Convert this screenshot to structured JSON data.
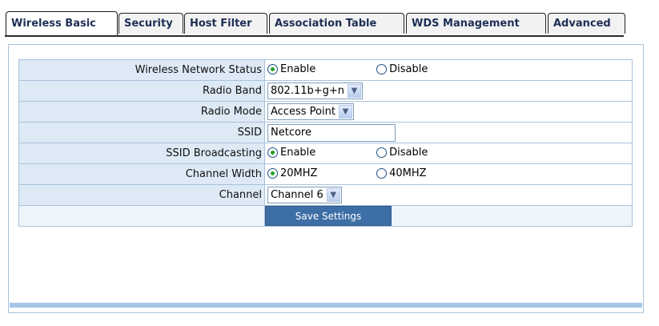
{
  "tabs": [
    {
      "label": "Wireless Basic",
      "active": true
    },
    {
      "label": "Security",
      "active": false
    },
    {
      "label": "Host Filter",
      "active": false
    },
    {
      "label": "Association Table",
      "active": false
    },
    {
      "label": "WDS Management",
      "active": false
    },
    {
      "label": "Advanced",
      "active": false
    }
  ],
  "form": {
    "network_status": {
      "label": "Wireless Network Status",
      "options": [
        "Enable",
        "Disable"
      ],
      "selected": "Enable"
    },
    "radio_band": {
      "label": "Radio Band",
      "value": "802.11b+g+n"
    },
    "radio_mode": {
      "label": "Radio Mode",
      "value": "Access Point"
    },
    "ssid": {
      "label": "SSID",
      "value": "Netcore"
    },
    "ssid_broadcasting": {
      "label": "SSID Broadcasting",
      "options": [
        "Enable",
        "Disable"
      ],
      "selected": "Enable"
    },
    "channel_width": {
      "label": "Channel Width",
      "options": [
        "20MHZ",
        "40MHZ"
      ],
      "selected": "20MHZ"
    },
    "channel": {
      "label": "Channel",
      "value": "Channel 6"
    },
    "save_label": "Save Settings"
  },
  "colors": {
    "label_bg": "#dde9f5",
    "border": "#a9c2dc",
    "button_bg": "#3e6ea6",
    "radio_dot": "#21a121"
  },
  "icons": {
    "dropdown": "chevron-down-icon",
    "radio": "radio-icon"
  }
}
